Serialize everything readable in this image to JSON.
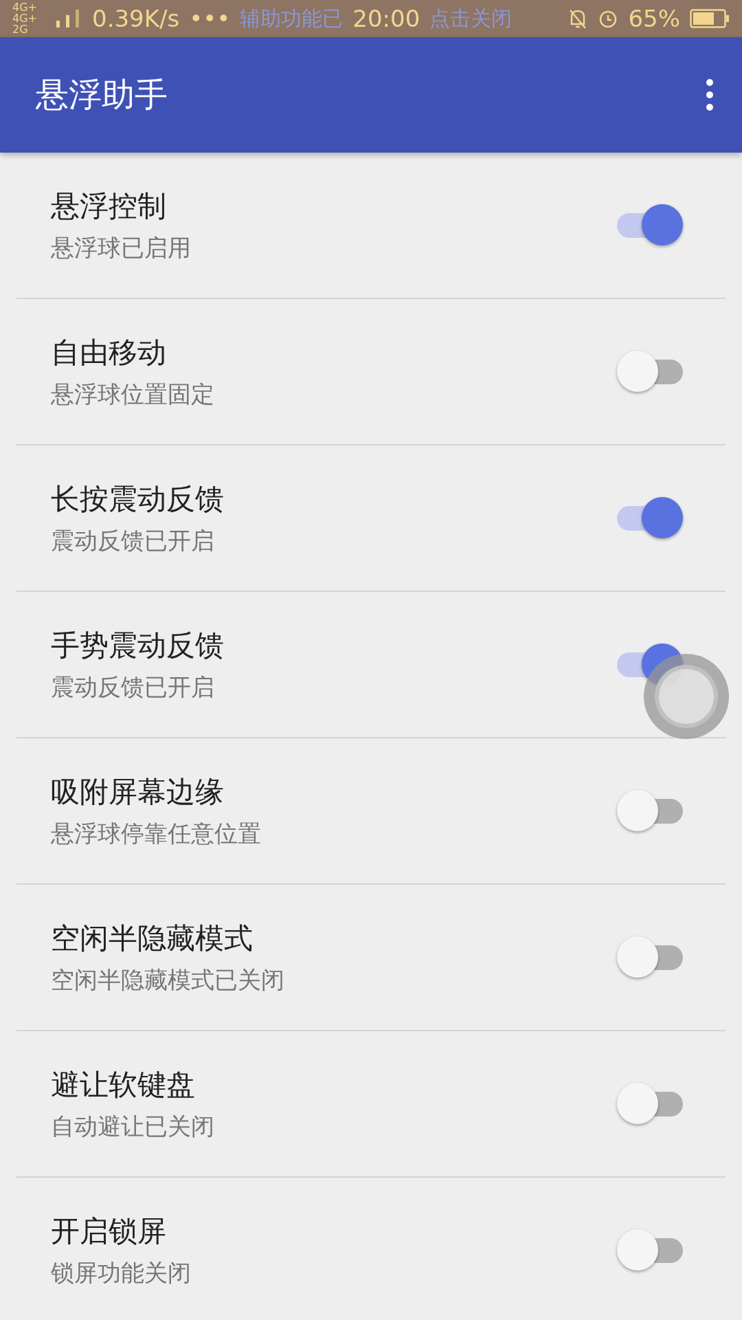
{
  "status_bar": {
    "network": "4G+ 4G+ 2G",
    "speed": "0.39K/s",
    "more": "•••",
    "notification": "辅助功能已",
    "time": "20:00",
    "notification_action": "点击关闭",
    "battery": "65%"
  },
  "app_bar": {
    "title": "悬浮助手"
  },
  "settings": [
    {
      "title": "悬浮控制",
      "subtitle": "悬浮球已启用",
      "on": true
    },
    {
      "title": "自由移动",
      "subtitle": "悬浮球位置固定",
      "on": false
    },
    {
      "title": "长按震动反馈",
      "subtitle": "震动反馈已开启",
      "on": true
    },
    {
      "title": "手势震动反馈",
      "subtitle": "震动反馈已开启",
      "on": true
    },
    {
      "title": "吸附屏幕边缘",
      "subtitle": "悬浮球停靠任意位置",
      "on": false
    },
    {
      "title": "空闲半隐藏模式",
      "subtitle": "空闲半隐藏模式已关闭",
      "on": false
    },
    {
      "title": "避让软键盘",
      "subtitle": "自动避让已关闭",
      "on": false
    },
    {
      "title": "开启锁屏",
      "subtitle": "锁屏功能关闭",
      "on": false
    }
  ]
}
